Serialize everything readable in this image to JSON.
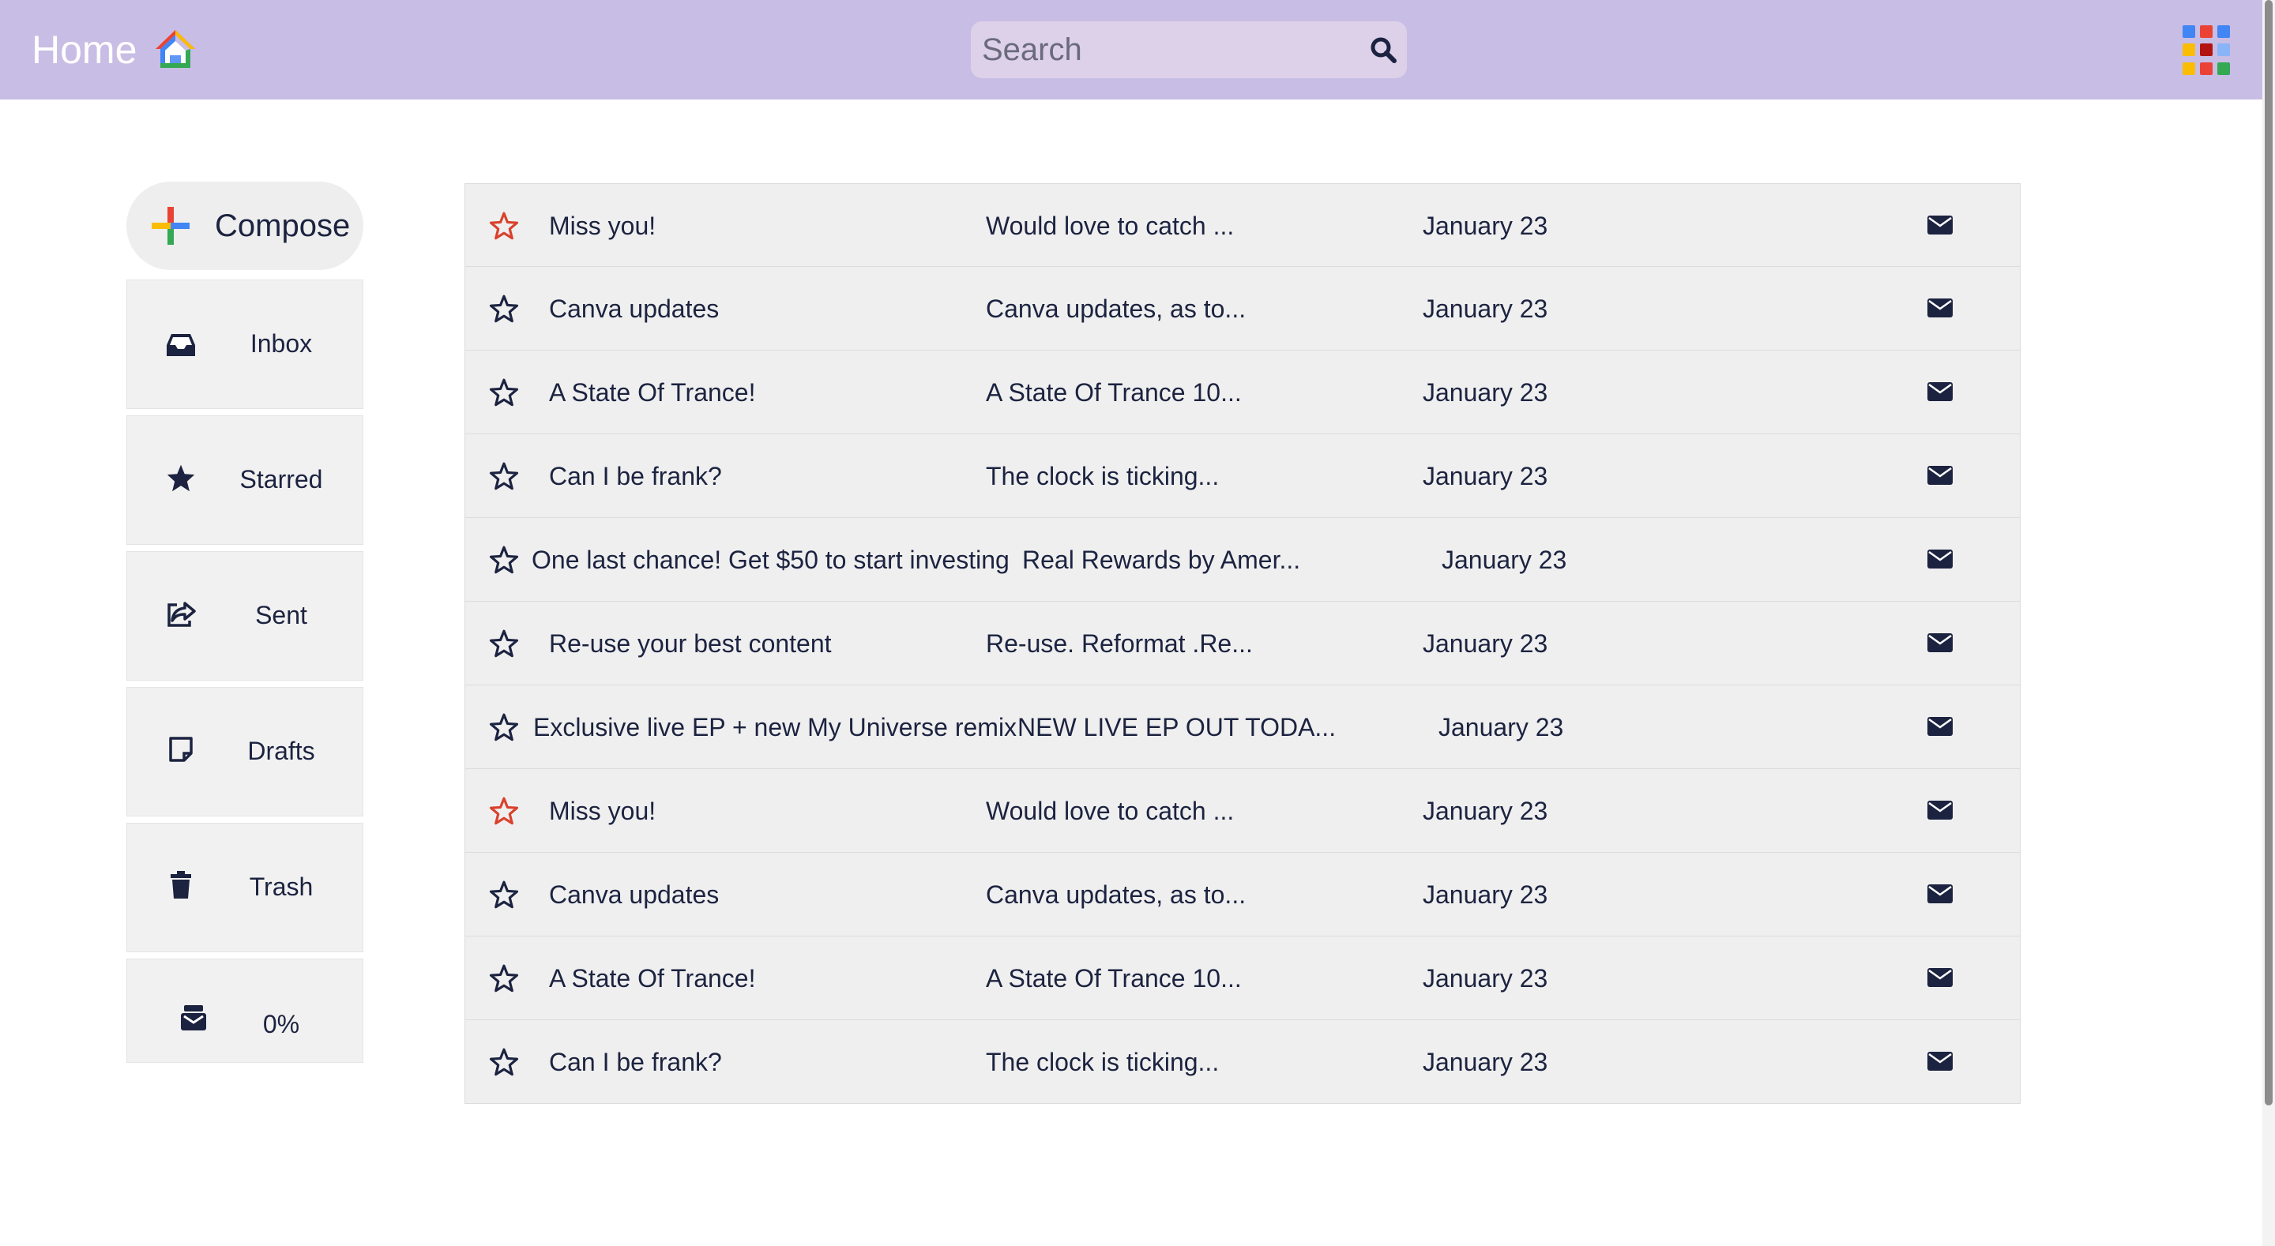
{
  "header": {
    "title": "Home",
    "logo_icon": "home-logo-icon",
    "search_placeholder": "Search",
    "search_icon": "search-icon",
    "apps_icon": "apps-grid-icon",
    "bg_color": "#c8bde4"
  },
  "sidebar": {
    "compose_label": "Compose",
    "items": [
      {
        "label": "Inbox",
        "icon": "inbox-icon"
      },
      {
        "label": "Starred",
        "icon": "star-icon"
      },
      {
        "label": "Sent",
        "icon": "share-icon"
      },
      {
        "label": "Drafts",
        "icon": "note-icon"
      },
      {
        "label": "Trash",
        "icon": "trash-icon"
      },
      {
        "label": "0%",
        "icon": "mail-bulk-icon"
      }
    ]
  },
  "emails": [
    {
      "sender": "Miss you!",
      "snippet": "Would love to catch ...",
      "date": "January 23",
      "starred": true
    },
    {
      "sender": "Canva updates",
      "snippet": "Canva updates, as to...",
      "date": "January 23",
      "starred": false
    },
    {
      "sender": "A State Of Trance!",
      "snippet": "A State Of Trance 10...",
      "date": "January 23",
      "starred": false
    },
    {
      "sender": "Can I be frank?",
      "snippet": "The clock is ticking...",
      "date": "January 23",
      "starred": false
    },
    {
      "sender": "One last chance! Get $50 to start investing",
      "snippet": "Real Rewards by Amer...",
      "date": "January 23",
      "starred": false
    },
    {
      "sender": "Re-use your best content",
      "snippet": "Re-use. Reformat .Re...",
      "date": "January 23",
      "starred": false
    },
    {
      "sender": "Exclusive live EP + new My Universe remix",
      "snippet": "NEW LIVE EP OUT TODA...",
      "date": "January 23",
      "starred": false
    },
    {
      "sender": "Miss you!",
      "snippet": "Would love to catch ...",
      "date": "January 23",
      "starred": true
    },
    {
      "sender": "Canva updates",
      "snippet": "Canva updates, as to...",
      "date": "January 23",
      "starred": false
    },
    {
      "sender": "A State Of Trance!",
      "snippet": "A State Of Trance 10...",
      "date": "January 23",
      "starred": false
    },
    {
      "sender": "Can I be frank?",
      "snippet": "The clock is ticking...",
      "date": "January 23",
      "starred": false
    }
  ],
  "colors": {
    "starred": "#d9412c",
    "unstarred": "#1c2340",
    "text": "#1c2340"
  }
}
